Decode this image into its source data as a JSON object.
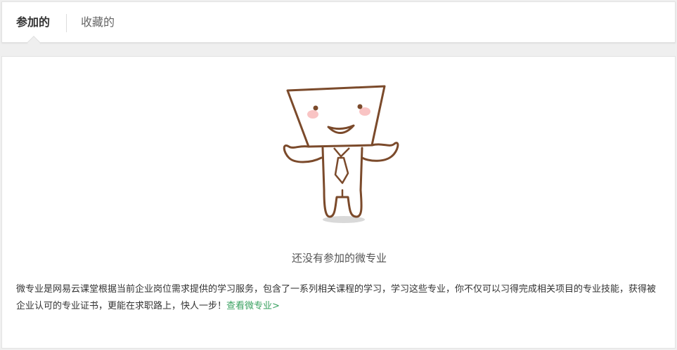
{
  "tabs": [
    {
      "label": "参加的",
      "active": true
    },
    {
      "label": "收藏的",
      "active": false
    }
  ],
  "empty_state": {
    "message": "还没有参加的微专业",
    "description": "微专业是网易云课堂根据当前企业岗位需求提供的学习服务，包含了一系列相关课程的学习，学习这些专业，你不仅可以习得完成相关项目的专业技能，获得被企业认可的专业证书，更能在求职路上，快人一步！",
    "link_label": "查看微专业>"
  },
  "colors": {
    "accent_green": "#39a160",
    "mascot_outline": "#7b4a2b",
    "cheek": "#f7b5b5"
  }
}
